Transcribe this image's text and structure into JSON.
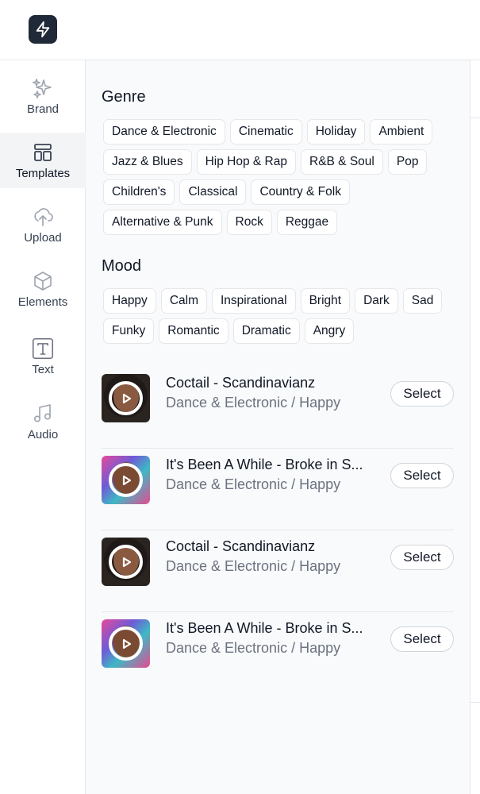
{
  "app": {
    "logo_icon": "lightning-icon"
  },
  "sidebar": {
    "items": [
      {
        "label": "Brand",
        "icon": "sparkles-icon"
      },
      {
        "label": "Templates",
        "icon": "layout-icon",
        "active": true
      },
      {
        "label": "Upload",
        "icon": "cloud-upload-icon"
      },
      {
        "label": "Elements",
        "icon": "cube-icon"
      },
      {
        "label": "Text",
        "icon": "text-icon"
      },
      {
        "label": "Audio",
        "icon": "music-note-icon"
      }
    ]
  },
  "genre": {
    "title": "Genre",
    "chips": [
      "Dance & Electronic",
      "Cinematic",
      "Holiday",
      "Ambient",
      "Jazz & Blues",
      "Hip Hop & Rap",
      "R&B & Soul",
      "Pop",
      "Children's",
      "Classical",
      "Country & Folk",
      "Alternative & Punk",
      "Rock",
      "Reggae"
    ]
  },
  "mood": {
    "title": "Mood",
    "chips": [
      "Happy",
      "Calm",
      "Inspirational",
      "Bright",
      "Dark",
      "Sad",
      "Funky",
      "Romantic",
      "Dramatic",
      "Angry"
    ]
  },
  "tracks": [
    {
      "title": "Coctail - Scandinavianz",
      "subtitle": "Dance & Electronic / Happy",
      "action": "Select"
    },
    {
      "title": "It's Been A While - Broke in S...",
      "subtitle": "Dance & Electronic / Happy",
      "action": "Select"
    },
    {
      "title": "Coctail - Scandinavianz",
      "subtitle": "Dance & Electronic / Happy",
      "action": "Select"
    },
    {
      "title": "It's Been A While - Broke in S...",
      "subtitle": "Dance & Electronic / Happy",
      "action": "Select"
    }
  ],
  "colors": {
    "panel_bg": "#f9fafb",
    "logo_bg": "#1f2937",
    "active_nav_bg": "#f3f4f6",
    "muted_text": "#6b7280"
  }
}
